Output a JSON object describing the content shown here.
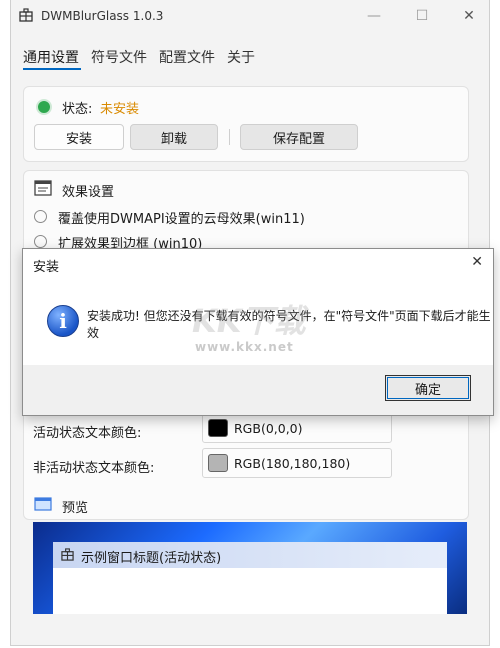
{
  "window": {
    "title": "DWMBlurGlass 1.0.3",
    "minimize": "—",
    "maximize": "☐",
    "close": "✕"
  },
  "tabs": [
    {
      "label": "通用设置"
    },
    {
      "label": "符号文件"
    },
    {
      "label": "配置文件"
    },
    {
      "label": "关于"
    }
  ],
  "status": {
    "label": "状态:",
    "value": "未安装",
    "dot_color": "#2fa84f",
    "value_color": "#d98a00"
  },
  "actions": {
    "install": "安装",
    "uninstall": "卸载",
    "save": "保存配置"
  },
  "effects": {
    "heading": "效果设置",
    "options": [
      {
        "label": "覆盖使用DWMAPI设置的云母效果(win11)"
      },
      {
        "label": "扩展效果到边框 (win10)"
      }
    ]
  },
  "colors": {
    "active_label": "活动状态文本颜色:",
    "active_value": "RGB(0,0,0)",
    "active_swatch": "#000000",
    "inactive_label": "非活动状态文本颜色:",
    "inactive_value": "RGB(180,180,180)",
    "inactive_swatch": "#b4b4b4"
  },
  "preview": {
    "heading": "预览",
    "window_title": "示例窗口标题(活动状态)"
  },
  "dialog": {
    "title": "安装",
    "close": "✕",
    "message_line1": "安装成功! 但您还没有下载有效的符号文件，在\"符号文件\"页面下载后才能生",
    "message_line2": "效",
    "ok": "确定",
    "icon": "info-icon"
  },
  "watermark": {
    "brand": "KK下载",
    "url": "www.kkx.net"
  }
}
